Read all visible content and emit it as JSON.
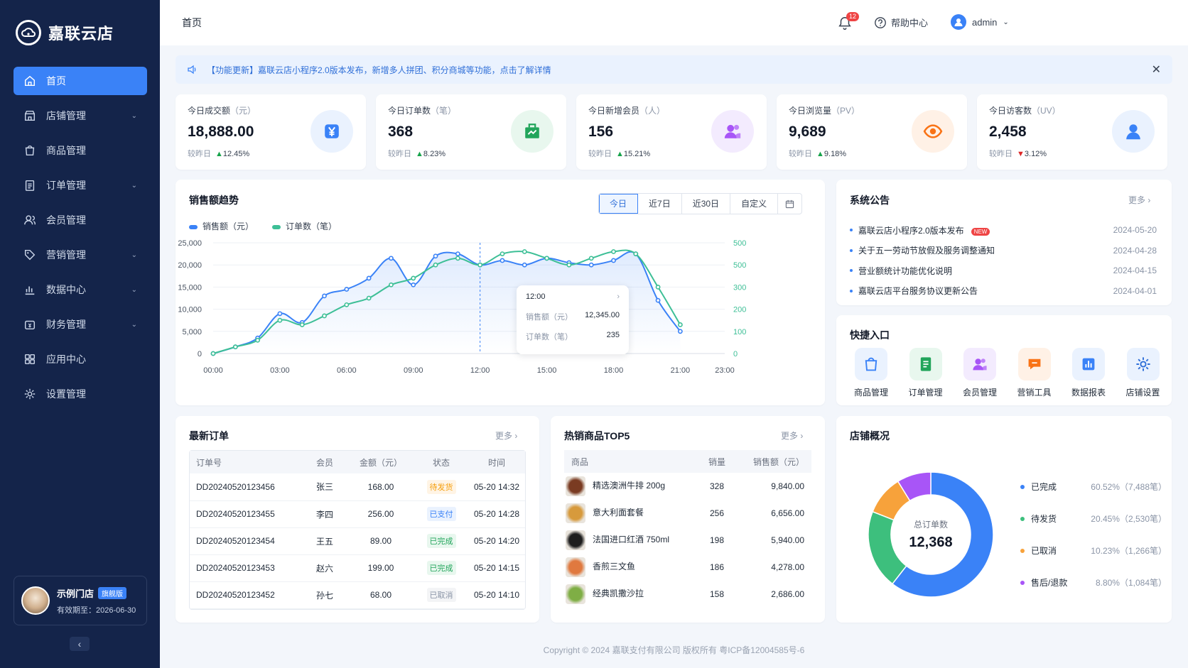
{
  "app": {
    "name": "嘉联云店"
  },
  "sidebar": {
    "items": [
      {
        "label": "首页",
        "icon": "home-icon",
        "active": true,
        "expandable": false
      },
      {
        "label": "店铺管理",
        "icon": "store-icon",
        "expandable": true
      },
      {
        "label": "商品管理",
        "icon": "bag-icon",
        "expandable": false
      },
      {
        "label": "订单管理",
        "icon": "clipboard-icon",
        "expandable": true
      },
      {
        "label": "会员管理",
        "icon": "users-icon",
        "expandable": false
      },
      {
        "label": "营销管理",
        "icon": "tag-icon",
        "expandable": true
      },
      {
        "label": "数据中心",
        "icon": "bar-chart-icon",
        "expandable": true
      },
      {
        "label": "财务管理",
        "icon": "wallet-icon",
        "expandable": true
      },
      {
        "label": "应用中心",
        "icon": "grid-icon",
        "expandable": false
      },
      {
        "label": "设置管理",
        "icon": "gear-icon",
        "expandable": false
      }
    ],
    "store": {
      "name": "示例门店",
      "badge": "旗舰版",
      "expiry": "有效期至：2026-06-30"
    }
  },
  "topbar": {
    "breadcrumb": "首页",
    "notification_count": "12",
    "help_label": "帮助中心",
    "user_name": "admin"
  },
  "announcement": {
    "text": "【功能更新】嘉联云店小程序2.0版本发布，新增多人拼团、积分商城等功能，点击了解详情"
  },
  "stats": [
    {
      "label": "今日成交额",
      "unit": "（元）",
      "value": "18,888.00",
      "compare_label": "较昨日",
      "change": "12.45%",
      "direction": "up",
      "icon": "yuan-icon",
      "color": "#3a82f7",
      "bg": "#eaf2fe"
    },
    {
      "label": "今日订单数",
      "unit": "（笔）",
      "value": "368",
      "compare_label": "较昨日",
      "change": "8.23%",
      "direction": "up",
      "icon": "order-icon",
      "color": "#22a55b",
      "bg": "#e8f7ee"
    },
    {
      "label": "今日新增会员",
      "unit": "（人）",
      "value": "156",
      "compare_label": "较昨日",
      "change": "15.21%",
      "direction": "up",
      "icon": "members-icon",
      "color": "#a855f7",
      "bg": "#f3ebfe"
    },
    {
      "label": "今日浏览量",
      "unit": "（PV）",
      "value": "9,689",
      "compare_label": "较昨日",
      "change": "9.18%",
      "direction": "up",
      "icon": "eye-icon",
      "color": "#f97316",
      "bg": "#fff1e6"
    },
    {
      "label": "今日访客数",
      "unit": "（UV）",
      "value": "2,458",
      "compare_label": "较昨日",
      "change": "3.12%",
      "direction": "down",
      "icon": "visitor-icon",
      "color": "#3a82f7",
      "bg": "#eaf2fe"
    }
  ],
  "sales_trend": {
    "title": "销售额趋势",
    "ranges": [
      "今日",
      "近7日",
      "近30日",
      "自定义"
    ],
    "selected_range": "今日",
    "tooltip": {
      "time": "12:00",
      "sales_label": "销售额（元）",
      "sales_value": "12,345.00",
      "orders_label": "订单数（笔）",
      "orders_value": "235"
    }
  },
  "chart_data": {
    "type": "line",
    "x": [
      "00:00",
      "01:00",
      "02:00",
      "03:00",
      "04:00",
      "05:00",
      "06:00",
      "07:00",
      "08:00",
      "09:00",
      "10:00",
      "11:00",
      "12:00",
      "13:00",
      "14:00",
      "15:00",
      "16:00",
      "17:00",
      "18:00",
      "19:00",
      "20:00",
      "21:00",
      "22:00",
      "23:00"
    ],
    "x_tick_labels": [
      "00:00",
      "03:00",
      "06:00",
      "09:00",
      "12:00",
      "15:00",
      "18:00",
      "21:00",
      "23:00"
    ],
    "series": [
      {
        "name": "销售额（元）",
        "axis": "left",
        "color": "#3a82f7",
        "values": [
          0,
          1500,
          3500,
          9000,
          7000,
          13000,
          14500,
          17000,
          21500,
          15500,
          22000,
          22500,
          20000,
          21000,
          20000,
          21500,
          20500,
          20000,
          21000,
          22500,
          12000,
          5000
        ]
      },
      {
        "name": "订单数（笔）",
        "axis": "right",
        "color": "#3dbf96",
        "values": [
          0,
          30,
          60,
          150,
          130,
          170,
          220,
          250,
          310,
          340,
          400,
          430,
          400,
          450,
          460,
          430,
          400,
          430,
          460,
          450,
          300,
          130
        ]
      }
    ],
    "y_left": {
      "ticks": [
        "25,000",
        "20,000",
        "15,000",
        "10,000",
        "5,000",
        "0"
      ],
      "range": [
        0,
        25000
      ]
    },
    "y_right": {
      "ticks": [
        "500",
        "500",
        "300",
        "200",
        "100",
        "0"
      ]
    },
    "grid": true,
    "legend": "top-left"
  },
  "announcements": {
    "title": "系统公告",
    "more": "更多",
    "items": [
      {
        "text": "嘉联云店小程序2.0版本发布",
        "date": "2024-05-20",
        "new": "NEW"
      },
      {
        "text": "关于五一劳动节放假及服务调整通知",
        "date": "2024-04-28"
      },
      {
        "text": "营业额统计功能优化说明",
        "date": "2024-04-15"
      },
      {
        "text": "嘉联云店平台服务协议更新公告",
        "date": "2024-04-01"
      }
    ]
  },
  "quick_entry": {
    "title": "快捷入口",
    "items": [
      {
        "label": "商品管理",
        "icon": "bag-icon",
        "color": "#3a82f7",
        "bg": "#eaf2fe"
      },
      {
        "label": "订单管理",
        "icon": "document-icon",
        "color": "#22a55b",
        "bg": "#e8f7ee"
      },
      {
        "label": "会员管理",
        "icon": "members-icon",
        "color": "#a855f7",
        "bg": "#f3ebfe"
      },
      {
        "label": "营销工具",
        "icon": "megaphone-icon",
        "color": "#f97316",
        "bg": "#fff1e6"
      },
      {
        "label": "数据报表",
        "icon": "report-icon",
        "color": "#3a82f7",
        "bg": "#eaf2fe"
      },
      {
        "label": "店铺设置",
        "icon": "gear-icon",
        "color": "#2f6fd8",
        "bg": "#eaf2fe"
      }
    ]
  },
  "recent_orders": {
    "title": "最新订单",
    "more": "更多",
    "columns": [
      "订单号",
      "会员",
      "金额（元）",
      "状态",
      "时间"
    ],
    "rows": [
      {
        "id": "DD20240520123456",
        "member": "张三",
        "amount": "168.00",
        "status": "待发货",
        "status_kind": "pend",
        "time": "05-20 14:32"
      },
      {
        "id": "DD20240520123455",
        "member": "李四",
        "amount": "256.00",
        "status": "已支付",
        "status_kind": "paid",
        "time": "05-20 14:28"
      },
      {
        "id": "DD20240520123454",
        "member": "王五",
        "amount": "89.00",
        "status": "已完成",
        "status_kind": "done",
        "time": "05-20 14:20"
      },
      {
        "id": "DD20240520123453",
        "member": "赵六",
        "amount": "199.00",
        "status": "已完成",
        "status_kind": "done",
        "time": "05-20 14:15"
      },
      {
        "id": "DD20240520123452",
        "member": "孙七",
        "amount": "68.00",
        "status": "已取消",
        "status_kind": "cancel",
        "time": "05-20 14:10"
      }
    ]
  },
  "top_products": {
    "title": "热销商品TOP5",
    "more": "更多",
    "columns": [
      "商品",
      "销量",
      "销售额（元）"
    ],
    "rows": [
      {
        "name": "精选澳洲牛排 200g",
        "qty": "328",
        "sales": "9,840.00",
        "thumb": "#7a3b22"
      },
      {
        "name": "意大利面套餐",
        "qty": "256",
        "sales": "6,656.00",
        "thumb": "#d79a3c"
      },
      {
        "name": "法国进口红酒 750ml",
        "qty": "198",
        "sales": "5,940.00",
        "thumb": "#1e1e1e"
      },
      {
        "name": "香煎三文鱼",
        "qty": "186",
        "sales": "4,278.00",
        "thumb": "#e0793f"
      },
      {
        "name": "经典凯撒沙拉",
        "qty": "158",
        "sales": "2,686.00",
        "thumb": "#7fae45"
      }
    ]
  },
  "store_overview": {
    "title": "店铺概况",
    "center_label": "总订单数",
    "center_value": "12,368",
    "segments": [
      {
        "name": "已完成",
        "percent": 60.52,
        "pct_label": "60.52%",
        "count": "（7,488笔）",
        "color": "#3a82f7"
      },
      {
        "name": "待发货",
        "percent": 20.45,
        "pct_label": "20.45%",
        "count": "（2,530笔）",
        "color": "#3dbf7d"
      },
      {
        "name": "已取消",
        "percent": 10.23,
        "pct_label": "10.23%",
        "count": "（1,266笔）",
        "color": "#f7a23b"
      },
      {
        "name": "售后/退款",
        "percent": 8.8,
        "pct_label": "8.80%",
        "count": "（1,084笔）",
        "color": "#a855f7"
      }
    ]
  },
  "footer": {
    "text": "Copyright © 2024 嘉联支付有限公司 版权所有 粤ICP备12004585号-6"
  }
}
